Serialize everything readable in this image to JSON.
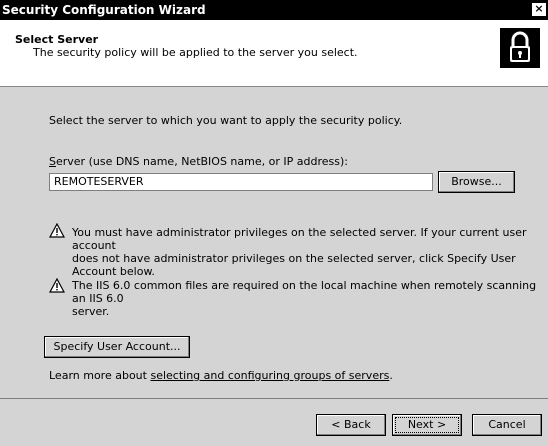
{
  "window": {
    "title": "Security Configuration Wizard",
    "close_label": "×"
  },
  "header": {
    "title": "Select Server",
    "subtitle": "The security policy will be applied to the server you select."
  },
  "main": {
    "instruction": "Select the server to which you want to apply the security policy.",
    "server_label": "Server (use DNS name, NetBIOS name, or IP address):",
    "server_value": "REMOTESERVER",
    "browse_label": "Browse...",
    "warnings": [
      {
        "lines": [
          "You must have administrator privileges on the selected server. If your current user account",
          "does not have administrator privileges on the selected server, click Specify User Account below."
        ]
      },
      {
        "lines": [
          "The IIS 6.0 common files are required on the local machine when remotely scanning an IIS 6.0",
          "server."
        ]
      }
    ],
    "specify_user_label": "Specify User Account...",
    "learn_prefix": "Learn more about ",
    "learn_link": "selecting and configuring groups of servers",
    "learn_suffix": "."
  },
  "footer": {
    "back_label": "< Back",
    "next_label": "Next >",
    "cancel_label": "Cancel"
  }
}
